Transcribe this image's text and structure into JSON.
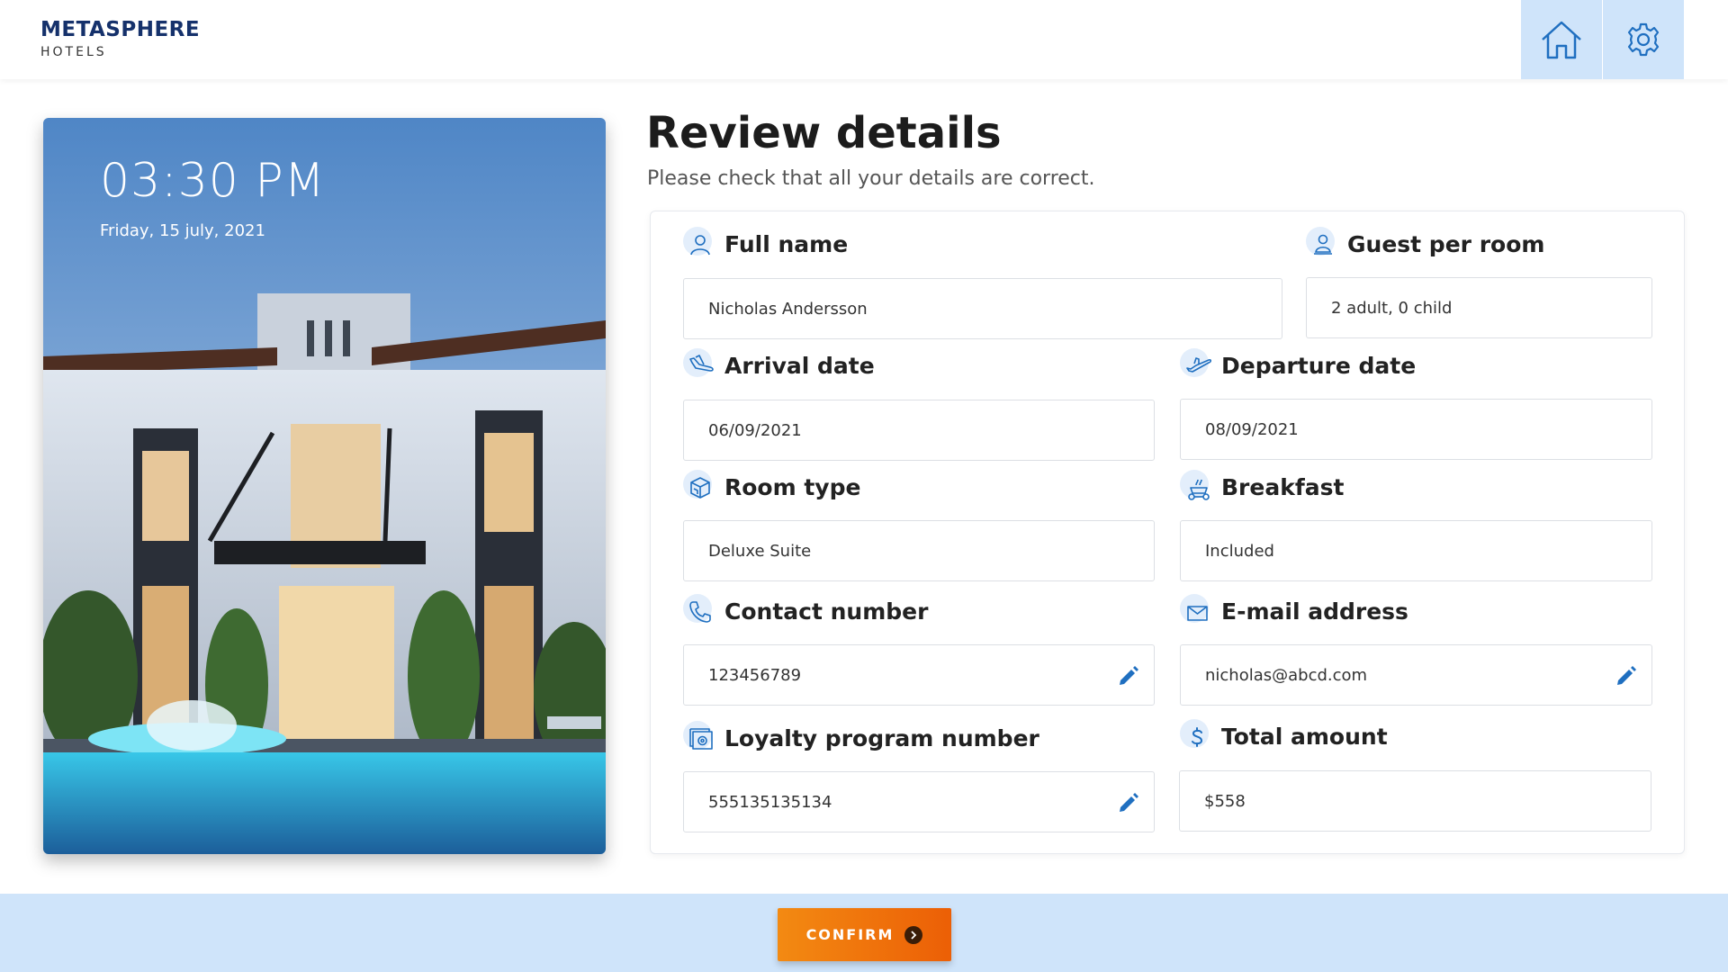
{
  "brand": {
    "name": "METASPHERE",
    "sub": "HOTELS"
  },
  "header": {
    "home_icon": "home-icon",
    "settings_icon": "gear-icon"
  },
  "clock": {
    "time": "03:30 PM",
    "date": "Friday, 15 july, 2021"
  },
  "page": {
    "title": "Review details",
    "subtitle": "Please check that all your details are correct."
  },
  "fields": {
    "full_name": {
      "label": "Full name",
      "value": "Nicholas Andersson",
      "icon": "person-icon"
    },
    "guests": {
      "label": "Guest per room",
      "value": "2 adult, 0 child",
      "icon": "guest-icon"
    },
    "arrival": {
      "label": "Arrival date",
      "value": "06/09/2021",
      "icon": "plane-landing-icon"
    },
    "departure": {
      "label": "Departure date",
      "value": "08/09/2021",
      "icon": "plane-takeoff-icon"
    },
    "room_type": {
      "label": "Room type",
      "value": "Deluxe Suite",
      "icon": "room-icon"
    },
    "breakfast": {
      "label": "Breakfast",
      "value": "Included",
      "icon": "breakfast-icon"
    },
    "contact": {
      "label": "Contact number",
      "value": "123456789",
      "icon": "phone-icon"
    },
    "email": {
      "label": "E-mail address",
      "value": "nicholas@abcd.com",
      "icon": "mail-icon"
    },
    "loyalty": {
      "label": "Loyalty program number",
      "value": "555135135134",
      "icon": "loyalty-card-icon"
    },
    "total": {
      "label": "Total amount",
      "value": "$558",
      "icon": "dollar-icon"
    }
  },
  "footer": {
    "confirm_label": "CONFIRM"
  },
  "colors": {
    "brand": "#15316b",
    "accent_light": "#cfe4fa",
    "icon_blue": "#1f6fc0",
    "confirm_orange": "#f07a0c"
  }
}
